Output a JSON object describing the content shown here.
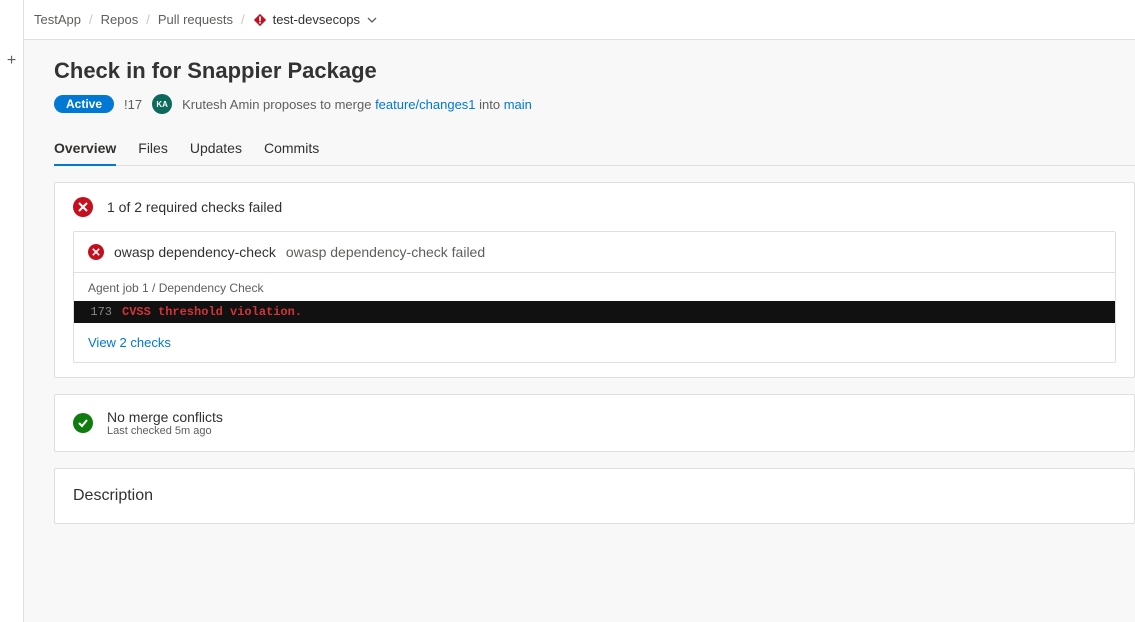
{
  "breadcrumb": {
    "project": "TestApp",
    "section": "Repos",
    "subsection": "Pull requests",
    "repo": "test-devsecops"
  },
  "title": "Check in for Snappier Package",
  "status_badge": "Active",
  "pr_id": "!17",
  "avatar_initials": "KA",
  "author": "Krutesh Amin",
  "propose_prefix": " proposes to merge ",
  "source_branch": "feature/changes1",
  "propose_mid": " into ",
  "target_branch": "main",
  "tabs": {
    "overview": "Overview",
    "files": "Files",
    "updates": "Updates",
    "commits": "Commits"
  },
  "checks": {
    "summary": "1 of 2 required checks failed",
    "item_name": "owasp dependency-check",
    "item_status": "owasp dependency-check failed",
    "job_label": "Agent job 1 / Dependency Check",
    "line_no": "173",
    "line_msg": "CVSS threshold violation.",
    "view_link": "View 2 checks"
  },
  "merge": {
    "title": "No merge conflicts",
    "sub": "Last checked 5m ago"
  },
  "description_heading": "Description"
}
